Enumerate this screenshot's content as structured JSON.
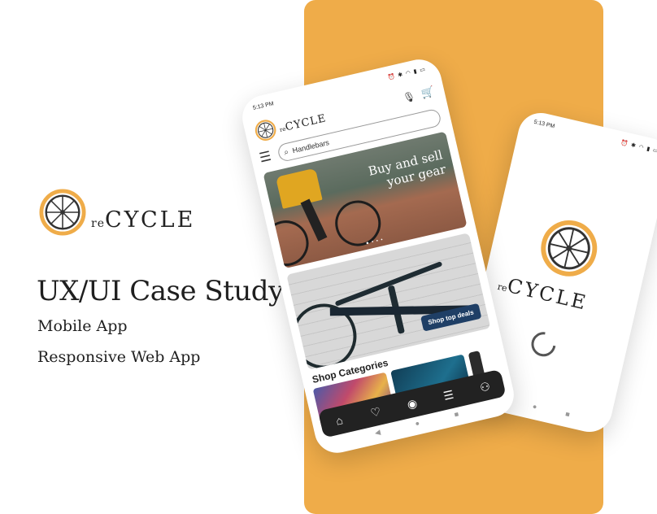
{
  "brand": {
    "prefix": "re",
    "name": "CYCLE"
  },
  "case_study": {
    "title": "UX/UI Case Study",
    "subtitle_1": "Mobile App",
    "subtitle_2": "Responsive Web App"
  },
  "colors": {
    "accent": "#EFAC49",
    "dark": "#222222",
    "button": "#1f3f66"
  },
  "splash_phone": {
    "time": "5:13 PM",
    "status_icons": "⏰ ✱ ◠ ▮ ▭",
    "brand_prefix": "re",
    "brand_name": "CYCLE",
    "sys_nav": {
      "back": "◀",
      "home": "●",
      "recent": "■"
    }
  },
  "app_phone": {
    "time": "5:13 PM",
    "status_icons": "⏰ ✱ ◠ ▮ ▭",
    "brand_prefix": "re",
    "brand_name": "CYCLE",
    "icons": {
      "mic": "🎙",
      "cart": "🛒",
      "menu": "☰",
      "search": "⌕"
    },
    "search_value": "Handlebars",
    "hero_text": "Buy and sell your gear",
    "hero_dots": "● • • •",
    "promo_button": "Shop top deals",
    "categories_title": "Shop Categories",
    "tabs": [
      {
        "name": "home",
        "glyph": "⌂"
      },
      {
        "name": "favorites",
        "glyph": "♡"
      },
      {
        "name": "camera",
        "glyph": "◉"
      },
      {
        "name": "messages",
        "glyph": "☰"
      },
      {
        "name": "profile",
        "glyph": "⚇"
      }
    ],
    "sys_nav": {
      "back": "◀",
      "home": "●",
      "recent": "■"
    }
  }
}
